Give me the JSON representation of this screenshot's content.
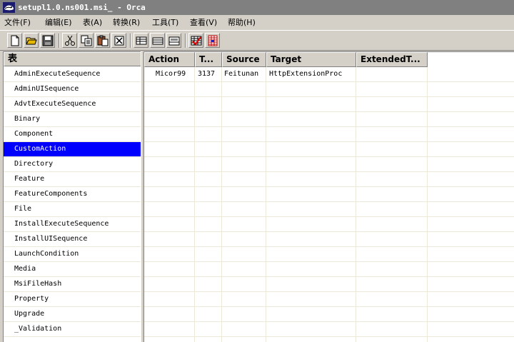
{
  "window": {
    "title": "setupl1.0.ns001.msi_ - Orca",
    "icon": "orca-app-icon"
  },
  "menubar": [
    {
      "label": "文件(F)"
    },
    {
      "label": "编辑(E)"
    },
    {
      "label": "表(A)"
    },
    {
      "label": "转换(R)"
    },
    {
      "label": "工具(T)"
    },
    {
      "label": "查看(V)"
    },
    {
      "label": "帮助(H)"
    }
  ],
  "toolbar": {
    "buttons": [
      "new-icon",
      "open-icon",
      "save-icon",
      "cut-icon",
      "copy-icon",
      "paste-icon",
      "delete-icon",
      "add-table-icon",
      "table-icon",
      "add-row-icon",
      "validate-icon",
      "merge-icon"
    ]
  },
  "tables_pane": {
    "header": "表",
    "items": [
      "AdminExecuteSequence",
      "AdminUISequence",
      "AdvtExecuteSequence",
      "Binary",
      "Component",
      "CustomAction",
      "Directory",
      "Feature",
      "FeatureComponents",
      "File",
      "InstallExecuteSequence",
      "InstallUISequence",
      "LaunchCondition",
      "Media",
      "MsiFileHash",
      "Property",
      "Upgrade",
      "_Validation"
    ],
    "selected": "CustomAction"
  },
  "data_grid": {
    "columns": [
      "Action",
      "T...",
      "Source",
      "Target",
      "ExtendedT..."
    ],
    "rows": [
      [
        "Micor99",
        "3137",
        "Feitunan",
        "HttpExtensionProc",
        ""
      ]
    ]
  },
  "colors": {
    "selection": "#0000ff",
    "title_bar_inactive": "#808080",
    "face": "#d4d0c8"
  }
}
